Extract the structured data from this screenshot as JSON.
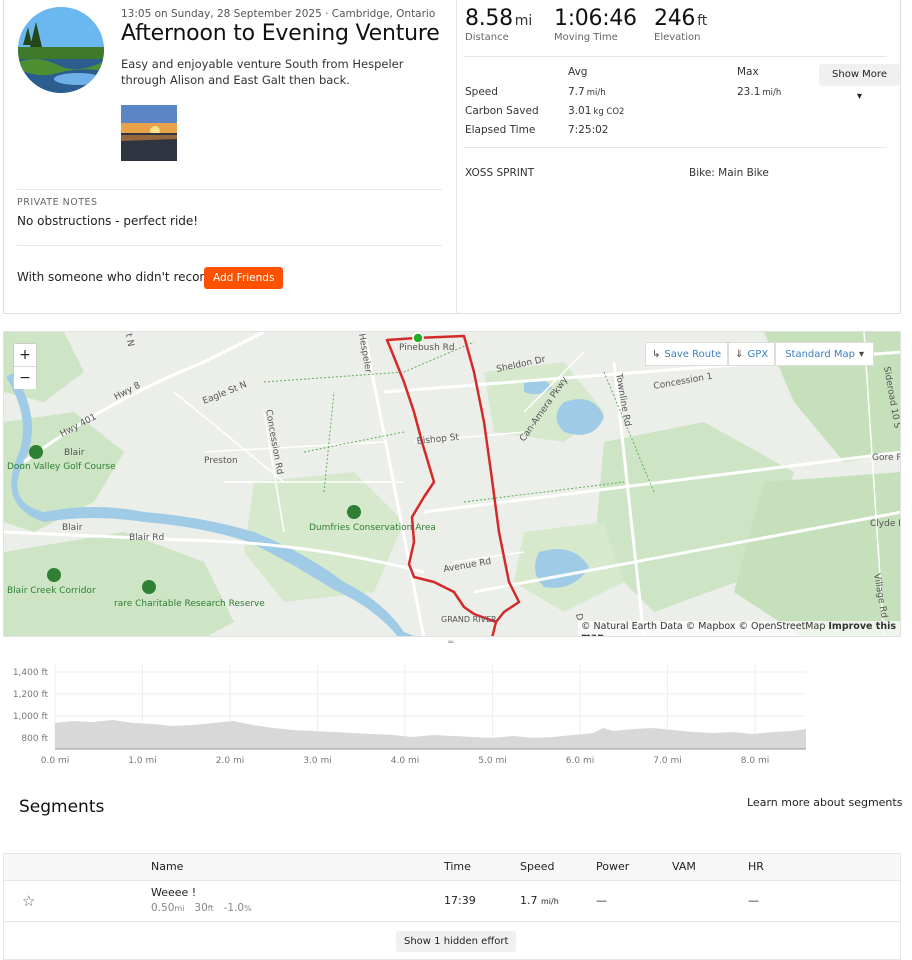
{
  "activity": {
    "meta": "13:05 on Sunday, 28 September 2025 · Cambridge, Ontario",
    "title": "Afternoon to Evening Venture",
    "description": "Easy and enjoyable venture South from Hespeler through Alison and East Galt then back.",
    "private_notes_label": "PRIVATE NOTES",
    "private_notes": "No obstructions - perfect ride!",
    "friends_prompt": "With someone who didn't record?",
    "add_friends_label": "Add Friends"
  },
  "stats": {
    "distance": {
      "value": "8.58",
      "unit": "mi",
      "label": "Distance"
    },
    "moving_time": {
      "value": "1:06:46",
      "label": "Moving Time"
    },
    "elevation": {
      "value": "246",
      "unit": "ft",
      "label": "Elevation"
    },
    "table": {
      "avg_header": "Avg",
      "max_header": "Max",
      "show_more_label": "Show More",
      "rows": [
        {
          "label": "Speed",
          "avg": "7.7",
          "avg_unit": "mi/h",
          "max": "23.1",
          "max_unit": "mi/h"
        },
        {
          "label": "Carbon Saved",
          "avg": "3.01",
          "avg_unit": "kg CO2"
        },
        {
          "label": "Elapsed Time",
          "avg": "7:25:02"
        }
      ]
    },
    "device": "XOSS SPRINT",
    "bike": "Bike: Main Bike"
  },
  "map": {
    "zoom_in": "+",
    "zoom_out": "−",
    "save_route": "Save Route",
    "gpx": "GPX",
    "map_style": "Standard Map",
    "attribution": "© Natural Earth Data © Mapbox © OpenStreetMap",
    "improve": "Improve this map",
    "labels": {
      "hwy401": "Hwy 401",
      "hwy8": "Hwy 8",
      "eagle": "Eagle St N",
      "concession": "Concession Rd",
      "preston": "Preston",
      "doon": "Doon Valley Golf Course",
      "dumfries": "Dumfries Conservation Area",
      "blair": "Blair",
      "blair_rd": "Blair Rd",
      "blair_creek": "Blair Creek Corridor",
      "rare": "rare Charitable Research Reserve",
      "grand_river": "GRAND RIVER",
      "pinebush": "Pinebush Rd",
      "sheldon": "Sheldon Dr",
      "can_amera": "Can-Amera Pkwy",
      "townline": "Townline Rd",
      "concession1": "Concession 1",
      "sideroad": "Sideroad 10 S",
      "bishop": "Bishop St",
      "avenue": "Avenue Rd",
      "gore": "Gore R",
      "clyde": "Clyde R",
      "village": "Village Rd",
      "hespeler": "Hespeler",
      "st_n": "t N",
      "d_frag": "D"
    }
  },
  "elevation_chart": {
    "y_ticks": [
      "1,400 ft",
      "1,200 ft",
      "1,000 ft",
      "800 ft"
    ],
    "x_ticks": [
      "0.0 mi",
      "1.0 mi",
      "2.0 mi",
      "3.0 mi",
      "4.0 mi",
      "5.0 mi",
      "6.0 mi",
      "7.0 mi",
      "8.0 mi"
    ]
  },
  "segments": {
    "title": "Segments",
    "learn_more": "Learn more about segments",
    "headers": {
      "name": "Name",
      "time": "Time",
      "speed": "Speed",
      "power": "Power",
      "vam": "VAM",
      "hr": "HR"
    },
    "rows": [
      {
        "name": "Weeee !",
        "distance": "0.50",
        "distance_unit": "mi",
        "elev": "30",
        "elev_unit": "ft",
        "grade": "-1.0",
        "grade_unit": "%",
        "time": "17:39",
        "speed": "1.7",
        "speed_unit": "mi/h",
        "power": "—",
        "hr": "—"
      }
    ],
    "hidden_label": "Show 1 hidden effort"
  },
  "colors": {
    "accent": "#fc5200",
    "route": "#d42a2a",
    "link": "#3a7fc1"
  }
}
